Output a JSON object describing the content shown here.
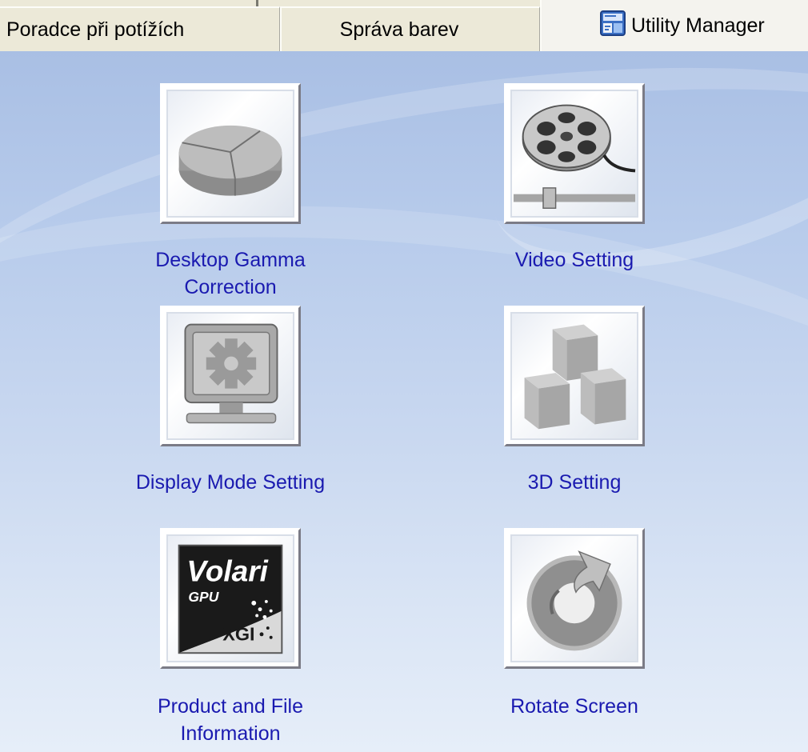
{
  "tabs": [
    {
      "label": "Poradce při potížích"
    },
    {
      "label": "Správa barev"
    },
    {
      "label": "Utility Manager"
    }
  ],
  "items": [
    {
      "label": "Desktop Gamma Correction",
      "icon": "gamma-pie-icon"
    },
    {
      "label": "Video Setting",
      "icon": "film-reel-icon"
    },
    {
      "label": "Display Mode Setting",
      "icon": "monitor-gear-icon"
    },
    {
      "label": "3D Setting",
      "icon": "cubes-icon"
    },
    {
      "label": "Product and File Information",
      "icon": "volari-xgi-logo-icon"
    },
    {
      "label": "Rotate Screen",
      "icon": "rotate-arrow-icon"
    }
  ],
  "logo": {
    "line1": "Volari",
    "line2": "GPU",
    "line3": "XGI"
  },
  "colors": {
    "label_text": "#1a1ab0",
    "tab_bg": "#ece9d8"
  }
}
